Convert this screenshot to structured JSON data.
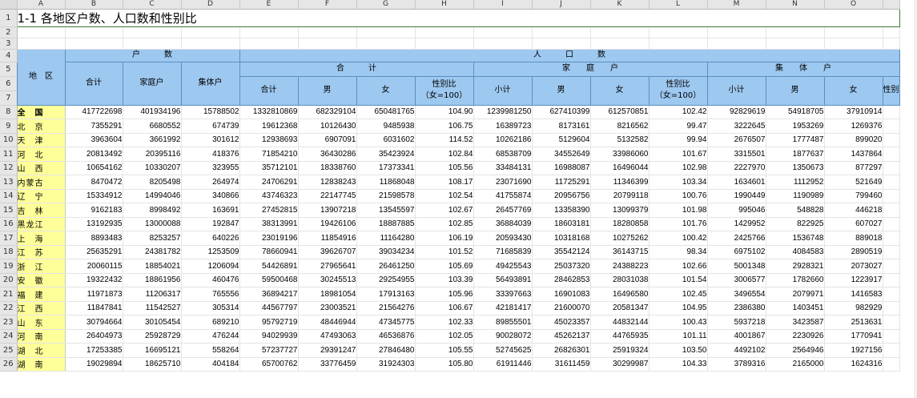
{
  "columns": [
    "A",
    "B",
    "C",
    "D",
    "E",
    "F",
    "G",
    "H",
    "I",
    "J",
    "K",
    "L",
    "M",
    "N",
    "O",
    ""
  ],
  "title": "1-1  各地区户数、人口数和性别比",
  "headers": {
    "region": "地　区",
    "households": "户　　　数",
    "population": "人　　　口　　　数",
    "total_group": "合　　　计",
    "family_group": "家　　庭　　户",
    "collective_group": "集　　体　　户",
    "h_total": "合计",
    "h_family": "家庭户",
    "h_collective": "集体户",
    "p_total": "合计",
    "male": "男",
    "female": "女",
    "sex_ratio": "性别比\n（女=100）",
    "subtotal": "小计",
    "partial_sex_ratio": "性别"
  },
  "row_numbers": [
    "1",
    "2",
    "3",
    "4",
    "5",
    "6",
    "7",
    "8",
    "9",
    "10",
    "11",
    "12",
    "13",
    "14",
    "15",
    "16",
    "17",
    "18",
    "19",
    "20",
    "21",
    "22",
    "23",
    "24",
    "25",
    "26"
  ],
  "rows": [
    {
      "region": "全　国",
      "bold": true,
      "v": [
        "417722698",
        "401934196",
        "15788502",
        "1332810869",
        "682329104",
        "650481765",
        "104.90",
        "1239981250",
        "627410399",
        "612570851",
        "102.42",
        "92829619",
        "54918705",
        "37910914"
      ]
    },
    {
      "region": "北　京",
      "v": [
        "7355291",
        "6680552",
        "674739",
        "19612368",
        "10126430",
        "9485938",
        "106.75",
        "16389723",
        "8173161",
        "8216562",
        "99.47",
        "3222645",
        "1953269",
        "1269376"
      ]
    },
    {
      "region": "天　津",
      "v": [
        "3963604",
        "3661992",
        "301612",
        "12938693",
        "6907091",
        "6031602",
        "114.52",
        "10262186",
        "5129604",
        "5132582",
        "99.94",
        "2676507",
        "1777487",
        "899020"
      ]
    },
    {
      "region": "河　北",
      "v": [
        "20813492",
        "20395116",
        "418376",
        "71854210",
        "36430286",
        "35423924",
        "102.84",
        "68538709",
        "34552649",
        "33986060",
        "101.67",
        "3315501",
        "1877637",
        "1437864"
      ]
    },
    {
      "region": "山　西",
      "v": [
        "10654162",
        "10330207",
        "323955",
        "35712101",
        "18338760",
        "17373341",
        "105.56",
        "33484131",
        "16988087",
        "16496044",
        "102.98",
        "2227970",
        "1350673",
        "877297"
      ]
    },
    {
      "region": "内蒙古",
      "v": [
        "8470472",
        "8205498",
        "264974",
        "24706291",
        "12838243",
        "11868048",
        "108.17",
        "23071690",
        "11725291",
        "11346399",
        "103.34",
        "1634601",
        "1112952",
        "521649"
      ]
    },
    {
      "region": "辽　宁",
      "v": [
        "15334912",
        "14994046",
        "340866",
        "43746323",
        "22147745",
        "21598578",
        "102.54",
        "41755874",
        "20956756",
        "20799118",
        "100.76",
        "1990449",
        "1190989",
        "799460"
      ]
    },
    {
      "region": "吉　林",
      "v": [
        "9162183",
        "8998492",
        "163691",
        "27452815",
        "13907218",
        "13545597",
        "102.67",
        "26457769",
        "13358390",
        "13099379",
        "101.98",
        "995046",
        "548828",
        "446218"
      ]
    },
    {
      "region": "黑龙江",
      "v": [
        "13192935",
        "13000088",
        "192847",
        "38313991",
        "19426106",
        "18887885",
        "102.85",
        "36884039",
        "18603181",
        "18280858",
        "101.76",
        "1429952",
        "822925",
        "607027"
      ]
    },
    {
      "region": "上　海",
      "v": [
        "8893483",
        "8253257",
        "640226",
        "23019196",
        "11854916",
        "11164280",
        "106.19",
        "20593430",
        "10318168",
        "10275262",
        "100.42",
        "2425766",
        "1536748",
        "889018"
      ]
    },
    {
      "region": "江　苏",
      "v": [
        "25635291",
        "24381782",
        "1253509",
        "78660941",
        "39626707",
        "39034234",
        "101.52",
        "71685839",
        "35542124",
        "36143715",
        "98.34",
        "6975102",
        "4084583",
        "2890519"
      ]
    },
    {
      "region": "浙　江",
      "v": [
        "20060115",
        "18854021",
        "1206094",
        "54426891",
        "27965641",
        "26461250",
        "105.69",
        "49425543",
        "25037320",
        "24388223",
        "102.66",
        "5001348",
        "2928321",
        "2073027"
      ]
    },
    {
      "region": "安　徽",
      "v": [
        "19322432",
        "18861956",
        "460476",
        "59500468",
        "30245513",
        "29254955",
        "103.39",
        "56493891",
        "28462853",
        "28031038",
        "101.54",
        "3006577",
        "1782660",
        "1223917"
      ]
    },
    {
      "region": "福　建",
      "v": [
        "11971873",
        "11206317",
        "765556",
        "36894217",
        "18981054",
        "17913163",
        "105.96",
        "33397663",
        "16901083",
        "16496580",
        "102.45",
        "3496554",
        "2079971",
        "1416583"
      ]
    },
    {
      "region": "江　西",
      "v": [
        "11847841",
        "11542527",
        "305314",
        "44567797",
        "23003521",
        "21564276",
        "106.67",
        "42181417",
        "21600070",
        "20581347",
        "104.95",
        "2386380",
        "1403451",
        "982929"
      ]
    },
    {
      "region": "山　东",
      "v": [
        "30794664",
        "30105454",
        "689210",
        "95792719",
        "48446944",
        "47345775",
        "102.33",
        "89855501",
        "45023357",
        "44832144",
        "100.43",
        "5937218",
        "3423587",
        "2513631"
      ]
    },
    {
      "region": "河　南",
      "v": [
        "26404973",
        "25928729",
        "476244",
        "94029939",
        "47493063",
        "46536876",
        "102.05",
        "90028072",
        "45262137",
        "44765935",
        "101.11",
        "4001867",
        "2230926",
        "1770941"
      ]
    },
    {
      "region": "湖　北",
      "v": [
        "17253385",
        "16695121",
        "558264",
        "57237727",
        "29391247",
        "27846480",
        "105.55",
        "52745625",
        "26826301",
        "25919324",
        "103.50",
        "4492102",
        "2564946",
        "1927156"
      ]
    },
    {
      "region": "湖　南",
      "v": [
        "19029894",
        "18625710",
        "404184",
        "65700762",
        "33776459",
        "31924303",
        "105.80",
        "61911446",
        "31611459",
        "30299987",
        "104.33",
        "3789316",
        "2165000",
        "1624316"
      ]
    }
  ]
}
